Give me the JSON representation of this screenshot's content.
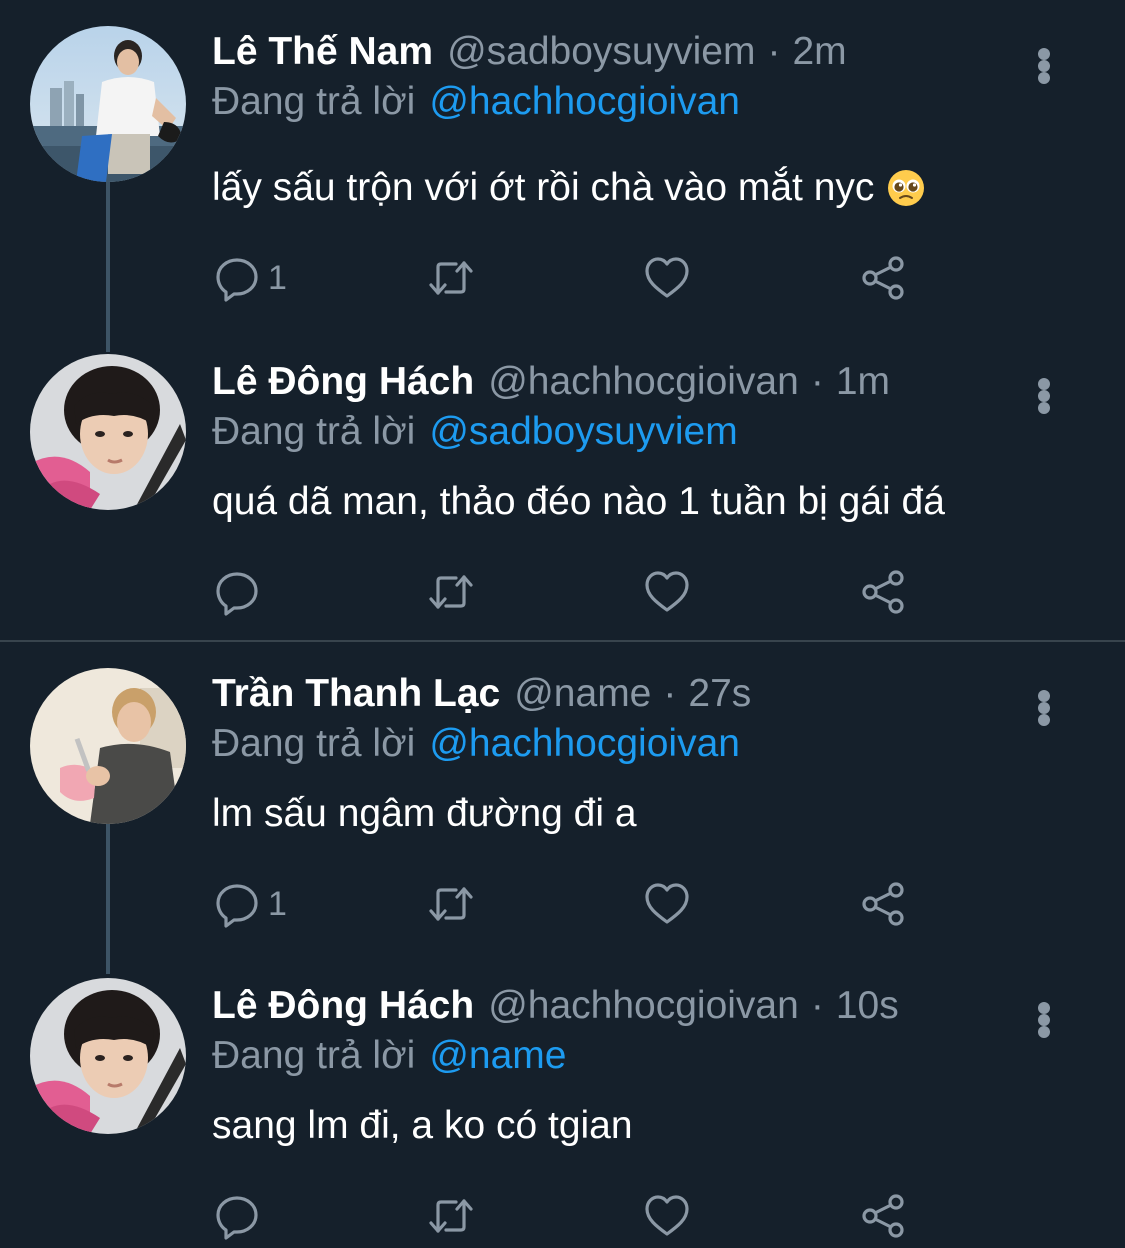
{
  "colors": {
    "background": "#15202b",
    "primary_text": "#ffffff",
    "secondary_text": "#8b98a5",
    "accent": "#1d9bf0",
    "thread_line": "#3d5466"
  },
  "tweets": [
    {
      "display_name": "Lê Thế Nam",
      "handle": "@sadboysuyviem",
      "separator": "·",
      "time": "2m",
      "reply_prefix": "Đang trả lời",
      "reply_to": "@hachhocgioivan",
      "text": "lấy sấu trộn với ớt rồi chà vào mắt nyc",
      "emoji": "pleading-face-emoji",
      "reply_count": "1"
    },
    {
      "display_name": "Lê Đông Hách",
      "handle": "@hachhocgioivan",
      "separator": "·",
      "time": "1m",
      "reply_prefix": "Đang trả lời",
      "reply_to": "@sadboysuyviem",
      "text": "quá dã man, thảo đéo nào 1 tuần bị gái đá",
      "reply_count": ""
    },
    {
      "display_name": "Trần Thanh Lạc",
      "handle": "@name",
      "separator": "·",
      "time": "27s",
      "reply_prefix": "Đang trả lời",
      "reply_to": "@hachhocgioivan",
      "text": "lm sấu ngâm đường đi a",
      "reply_count": "1"
    },
    {
      "display_name": "Lê Đông Hách",
      "handle": "@hachhocgioivan",
      "separator": "·",
      "time": "10s",
      "reply_prefix": "Đang trả lời",
      "reply_to": "@name",
      "text": "sang lm đi, a ko có tgian",
      "reply_count": ""
    }
  ],
  "icons": {
    "reply": "reply-icon",
    "retweet": "retweet-icon",
    "like": "heart-icon",
    "share": "share-icon",
    "more": "more-options-icon"
  }
}
